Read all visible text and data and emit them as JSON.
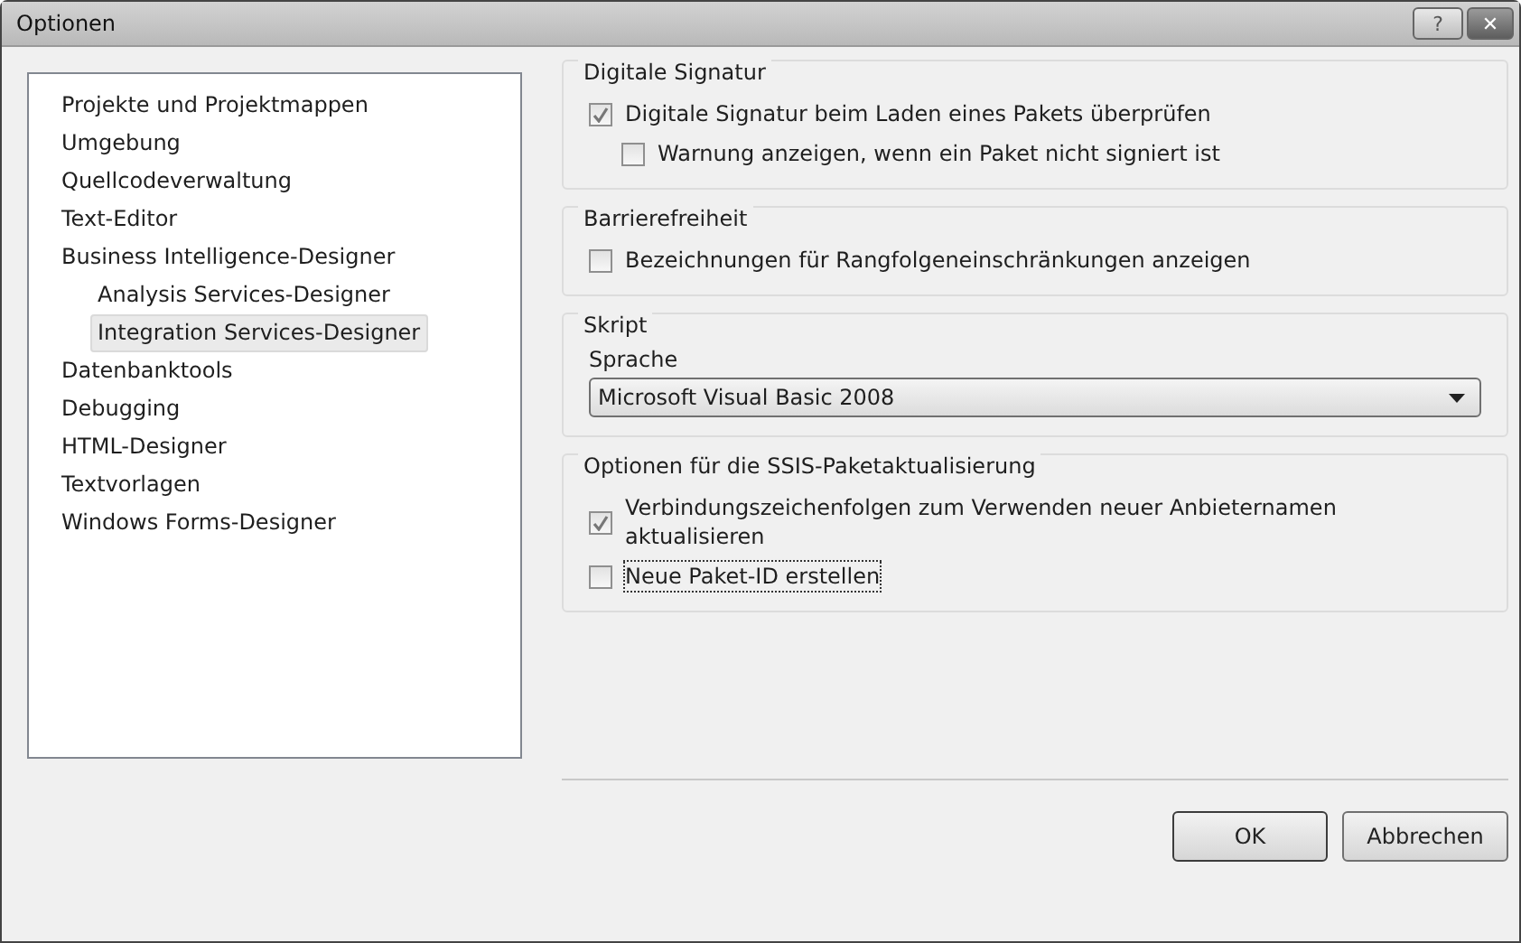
{
  "window": {
    "title": "Optionen",
    "buttons": [
      {
        "kind": "help",
        "label": "?"
      },
      {
        "kind": "close",
        "label": "✕"
      }
    ]
  },
  "tree": {
    "items": [
      {
        "label": "Projekte und Projektmappen",
        "selected": false
      },
      {
        "label": "Umgebung",
        "selected": false
      },
      {
        "label": "Quellcodeverwaltung",
        "selected": false
      },
      {
        "label": "Text-Editor",
        "selected": false
      },
      {
        "label": "Business Intelligence-Designer",
        "selected": false,
        "children": [
          {
            "label": "Analysis Services-Designer",
            "selected": false
          },
          {
            "label": "Integration Services-Designer",
            "selected": true
          }
        ]
      },
      {
        "label": "Datenbanktools",
        "selected": false
      },
      {
        "label": "Debugging",
        "selected": false
      },
      {
        "label": "HTML-Designer",
        "selected": false
      },
      {
        "label": "Textvorlagen",
        "selected": false
      },
      {
        "label": "Windows Forms-Designer",
        "selected": false
      }
    ]
  },
  "groups": [
    {
      "title": "Digitale Signatur",
      "controls": [
        {
          "kind": "checkbox",
          "label": "Digitale Signatur beim Laden eines Pakets überprüfen",
          "checked": true,
          "focused": false,
          "children": [
            {
              "kind": "checkbox",
              "label": "Warnung anzeigen, wenn ein Paket nicht signiert ist",
              "checked": false,
              "focused": false
            }
          ]
        }
      ]
    },
    {
      "title": "Barrierefreiheit",
      "controls": [
        {
          "kind": "checkbox",
          "label": "Bezeichnungen für Rangfolgeneinschränkungen anzeigen",
          "checked": false,
          "focused": false
        }
      ]
    },
    {
      "title": "Skript",
      "controls": [
        {
          "kind": "dropdown",
          "label": "Sprache",
          "value": "Microsoft Visual Basic 2008"
        }
      ]
    },
    {
      "title": "Optionen für die SSIS-Paketaktualisierung",
      "controls": [
        {
          "kind": "checkbox",
          "label": "Verbindungszeichenfolgen zum Verwenden neuer Anbieternamen aktualisieren",
          "checked": true,
          "focused": false
        },
        {
          "kind": "checkbox",
          "label": "Neue Paket-ID erstellen",
          "checked": false,
          "focused": true
        }
      ]
    }
  ],
  "buttons": [
    {
      "label": "OK",
      "default": true
    },
    {
      "label": "Abbrechen",
      "default": false
    }
  ]
}
